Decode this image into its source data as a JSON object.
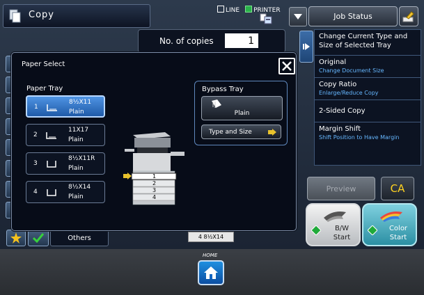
{
  "header": {
    "title": "Copy",
    "line_label": "LINE",
    "printer_label": "PRINTER",
    "job_status": "Job Status"
  },
  "copies": {
    "label": "No. of copies",
    "value": "1"
  },
  "right_menu": [
    {
      "main": "Change Current Type and Size of Selected Tray",
      "sub": ""
    },
    {
      "main": "Original",
      "sub": "Change Document Size"
    },
    {
      "main": "Copy Ratio",
      "sub": "Enlarge/Reduce Copy"
    },
    {
      "main": "2-Sided Copy",
      "sub": ""
    },
    {
      "main": "Margin Shift",
      "sub": "Shift Position to Have Margin"
    }
  ],
  "preview": "Preview",
  "ca": "CA",
  "bw_start": {
    "line1": "B/W",
    "line2": "Start"
  },
  "color_start": {
    "line1": "Color",
    "line2": "Start"
  },
  "others": "Others",
  "tray_indicator": "4  8½X14",
  "dialog": {
    "title": "Paper Select",
    "paper_tray_label": "Paper Tray",
    "trays": [
      {
        "num": "1",
        "size": "8½X11",
        "media": "Plain",
        "selected": true
      },
      {
        "num": "2",
        "size": "11X17",
        "media": "Plain",
        "selected": false
      },
      {
        "num": "3",
        "size": "8½X11R",
        "media": "Plain",
        "selected": false
      },
      {
        "num": "4",
        "size": "8½X14",
        "media": "Plain",
        "selected": false
      }
    ],
    "bypass_label": "Bypass Tray",
    "bypass_media": "Plain",
    "type_and_size": "Type and Size",
    "machine_trays": [
      "1",
      "2",
      "3",
      "4"
    ]
  },
  "home_label": "HOME",
  "colors": {
    "accent": "#2f79d6",
    "ca_yellow": "#ffd21f",
    "link_blue": "#66b7ff"
  }
}
